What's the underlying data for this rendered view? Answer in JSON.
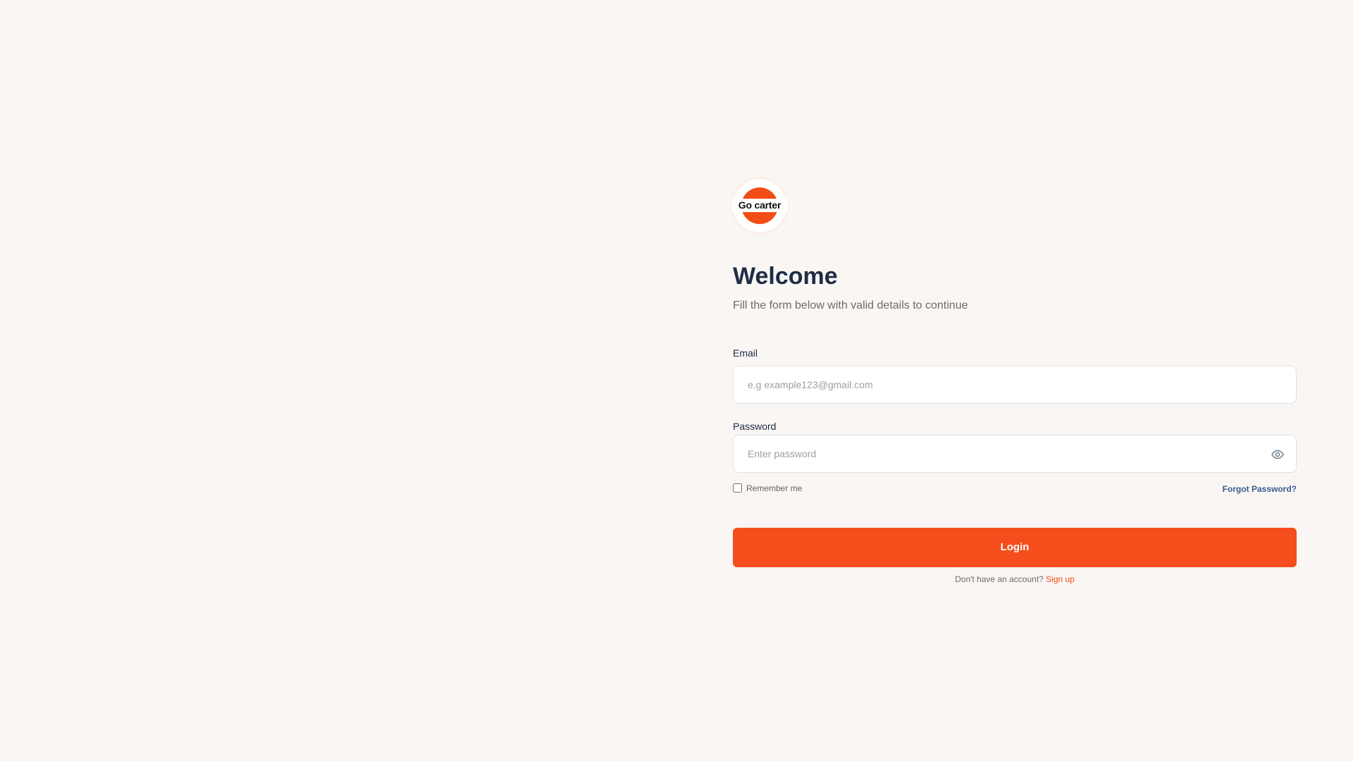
{
  "logo": {
    "text": "Go carter"
  },
  "header": {
    "title": "Welcome",
    "subtitle": "Fill the form below with valid details to continue"
  },
  "form": {
    "email_label": "Email",
    "email_placeholder": "e.g example123@gmail.com",
    "email_value": "",
    "password_label": "Password",
    "password_placeholder": "Enter password",
    "password_value": "",
    "remember_label": "Remember me",
    "remember_checked": false,
    "forgot_label": "Forgot Password?",
    "login_label": "Login",
    "signup_prompt": "Don't have an account?",
    "signup_label": "Sign up"
  },
  "icons": {
    "password_toggle": "eye-icon"
  },
  "colors": {
    "background": "#f9f6f4",
    "accent": "#f54d1b",
    "heading": "#1e2d45",
    "link": "#3b5b8f"
  }
}
